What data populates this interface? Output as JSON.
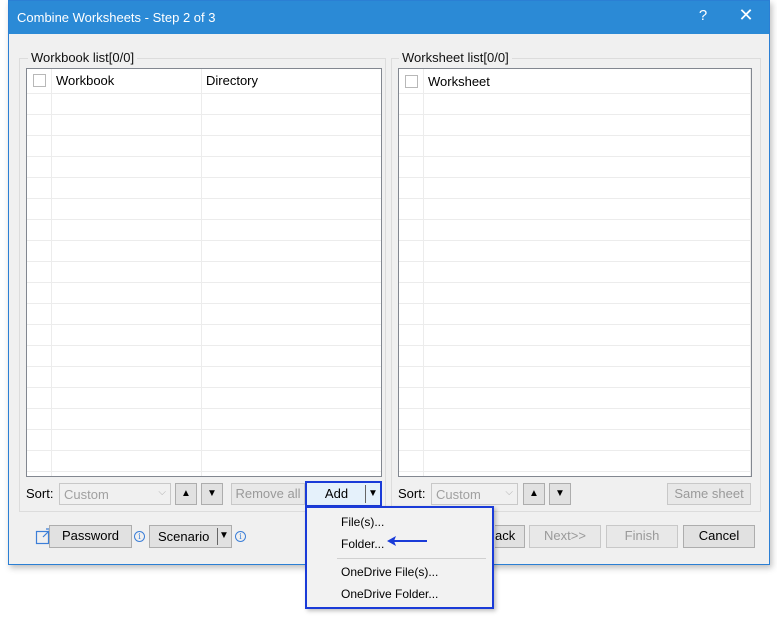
{
  "window": {
    "title": "Combine Worksheets - Step 2 of 3",
    "help_glyph": "?",
    "close_glyph": "✕"
  },
  "workbook_group": {
    "label": "Workbook list[0/0]",
    "columns": [
      "Workbook",
      "Directory"
    ]
  },
  "worksheet_group": {
    "label": "Worksheet list[0/0]",
    "columns": [
      "Worksheet"
    ]
  },
  "left_controls": {
    "sort_label": "Sort:",
    "sort_value": "Custom",
    "remove_all_label": "Remove all",
    "add_label": "Add"
  },
  "right_controls": {
    "sort_label": "Sort:",
    "sort_value": "Custom",
    "same_sheet_label": "Same sheet"
  },
  "add_menu": {
    "items": [
      "File(s)...",
      "Folder...",
      "OneDrive File(s)...",
      "OneDrive Folder..."
    ]
  },
  "footer": {
    "password_label": "Password",
    "scenario_label": "Scenario",
    "back_label": "ack",
    "next_label": "Next>>",
    "finish_label": "Finish",
    "cancel_label": "Cancel"
  },
  "colors": {
    "titlebar": "#2b8ad6",
    "highlight": "#1a3bd8"
  },
  "icons": [
    "help-icon",
    "close-icon",
    "checkbox-icon",
    "arrow-up-icon",
    "arrow-down-icon",
    "dropdown-arrow-icon",
    "external-link-icon",
    "info-icon",
    "pointer-arrow-icon"
  ]
}
